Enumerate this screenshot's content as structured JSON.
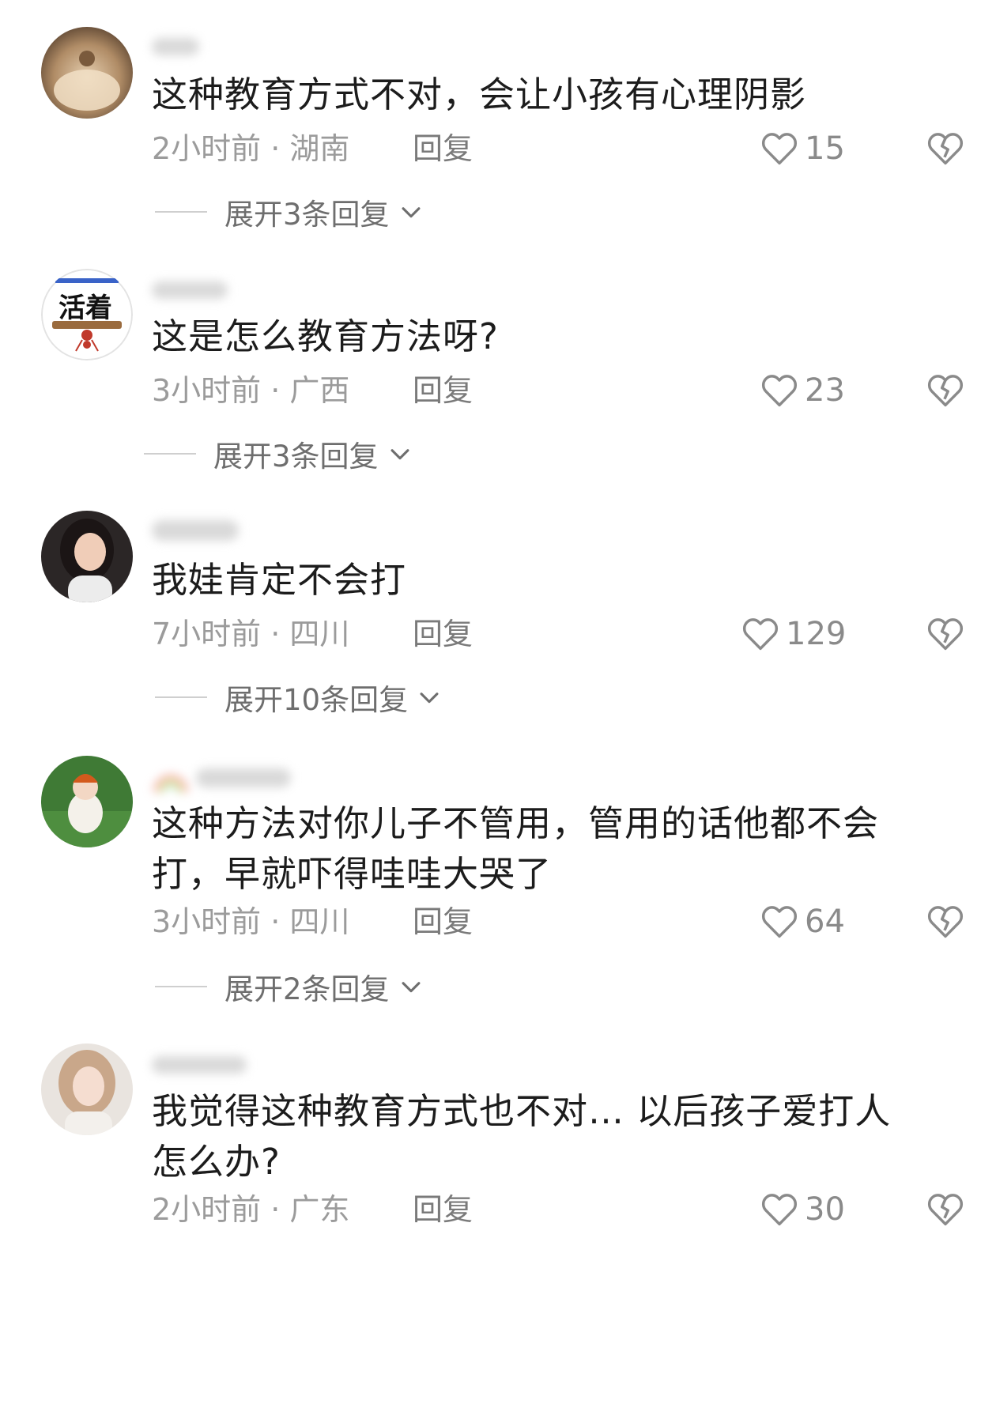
{
  "comments": [
    {
      "text": "这种教育方式不对，会让小孩有心理阴影",
      "time_location": "2小时前 · 湖南",
      "reply_label": "回复",
      "likes": "15",
      "expand_label": "展开3条回复"
    },
    {
      "text": "这是怎么教育方法呀?",
      "time_location": "3小时前 · 广西",
      "reply_label": "回复",
      "likes": "23",
      "expand_label": "展开3条回复"
    },
    {
      "text": "我娃肯定不会打",
      "time_location": "7小时前 · 四川",
      "reply_label": "回复",
      "likes": "129",
      "expand_label": "展开10条回复"
    },
    {
      "text_line1": "这种方法对你儿子不管用，管用的话他都不会",
      "text_line2": "打，早就吓得哇哇大哭了",
      "time_location": "3小时前 · 四川",
      "reply_label": "回复",
      "likes": "64",
      "expand_label": "展开2条回复"
    },
    {
      "text_line1": "我觉得这种教育方式也不对… 以后孩子爱打人",
      "text_line2": "怎么办?",
      "time_location": "2小时前 · 广东",
      "reply_label": "回复",
      "likes": "30"
    }
  ],
  "avatar2_logo_text": "活着",
  "icons": {
    "like": "heart-outline-icon",
    "dislike": "broken-heart-icon",
    "expand": "chevron-down-icon"
  },
  "colors": {
    "text": "#1c1c1c",
    "meta": "#9b9b9b",
    "icon": "#8a8a8a"
  }
}
